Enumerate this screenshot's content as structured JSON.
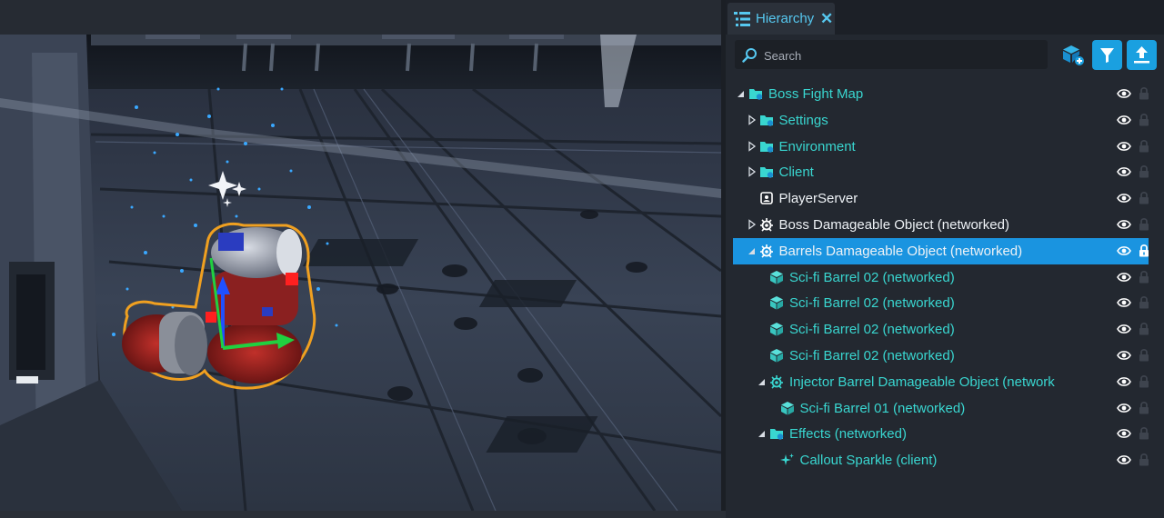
{
  "hierarchy": {
    "tab_title": "Hierarchy",
    "search": {
      "placeholder": "Search",
      "value": ""
    },
    "toolbar": {
      "create_icon": "create-object-icon",
      "filter_icon": "filter-icon",
      "upload_icon": "upload-icon",
      "accent": "#1aa0e0"
    },
    "items": [
      {
        "label": "Boss Fight Map",
        "depth": 0,
        "arrow": "expanded",
        "icon": "folder-icon",
        "color": "cyan",
        "selected": false,
        "locked": false
      },
      {
        "label": "Settings",
        "depth": 1,
        "arrow": "collapsed",
        "icon": "folder-icon",
        "color": "cyan",
        "selected": false,
        "locked": false
      },
      {
        "label": "Environment",
        "depth": 1,
        "arrow": "collapsed",
        "icon": "folder-icon",
        "color": "cyan",
        "selected": false,
        "locked": false
      },
      {
        "label": "Client",
        "depth": 1,
        "arrow": "collapsed",
        "icon": "folder-icon",
        "color": "cyan",
        "selected": false,
        "locked": false
      },
      {
        "label": "PlayerServer",
        "depth": 1,
        "arrow": "none",
        "icon": "player-settings-icon",
        "color": "white",
        "selected": false,
        "locked": false
      },
      {
        "label": "Boss Damageable Object (networked)",
        "depth": 1,
        "arrow": "collapsed",
        "icon": "damageable-object-icon",
        "color": "white",
        "selected": false,
        "locked": false
      },
      {
        "label": "Barrels Damageable Object (networked)",
        "depth": 1,
        "arrow": "expanded",
        "icon": "damageable-object-icon",
        "color": "white",
        "selected": true,
        "locked": true
      },
      {
        "label": "Sci-fi Barrel 02 (networked)",
        "depth": 2,
        "arrow": "none",
        "icon": "cube-icon",
        "color": "cyan",
        "selected": false,
        "locked": false
      },
      {
        "label": "Sci-fi Barrel 02 (networked)",
        "depth": 2,
        "arrow": "none",
        "icon": "cube-icon",
        "color": "cyan",
        "selected": false,
        "locked": false
      },
      {
        "label": "Sci-fi Barrel 02 (networked)",
        "depth": 2,
        "arrow": "none",
        "icon": "cube-icon",
        "color": "cyan",
        "selected": false,
        "locked": false
      },
      {
        "label": "Sci-fi Barrel 02 (networked)",
        "depth": 2,
        "arrow": "none",
        "icon": "cube-icon",
        "color": "cyan",
        "selected": false,
        "locked": false
      },
      {
        "label": "Injector Barrel Damageable Object (network",
        "depth": 2,
        "arrow": "expanded",
        "icon": "damageable-object-icon",
        "color": "cyan",
        "selected": false,
        "locked": false
      },
      {
        "label": "Sci-fi Barrel 01 (networked)",
        "depth": 3,
        "arrow": "none",
        "icon": "cube-icon",
        "color": "cyan",
        "selected": false,
        "locked": false
      },
      {
        "label": "Effects (networked)",
        "depth": 2,
        "arrow": "expanded",
        "icon": "folder-icon",
        "color": "cyan",
        "selected": false,
        "locked": false
      },
      {
        "label": "Callout Sparkle (client)",
        "depth": 3,
        "arrow": "none",
        "icon": "sparkle-icon",
        "color": "cyan",
        "selected": false,
        "locked": false
      }
    ]
  },
  "viewport": {
    "description_icons": [
      "move-gizmo",
      "sparkle-effect"
    ],
    "colors": {
      "selection_outline": "#f0a020",
      "gizmo_x": "#20d040",
      "gizmo_y": "#2050ff",
      "gizmo_z": "#ff2020",
      "particles": "#3aa8ff"
    }
  }
}
